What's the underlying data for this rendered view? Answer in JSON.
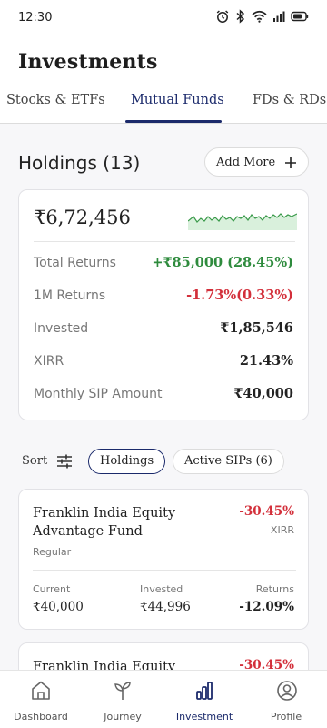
{
  "status": {
    "time": "12:30"
  },
  "page": {
    "title": "Investments"
  },
  "tabs": [
    {
      "label": "Stocks & ETFs",
      "active": false
    },
    {
      "label": "Mutual Funds",
      "active": true
    },
    {
      "label": "FDs & RDs",
      "active": false
    }
  ],
  "holdings": {
    "title": "Holdings (13)",
    "add_more_label": "Add More"
  },
  "summary": {
    "total_value": "₹6,72,456",
    "rows": [
      {
        "label": "Total Returns",
        "value": "+₹85,000 (28.45%)",
        "tone": "positive"
      },
      {
        "label": "1M Returns",
        "value": "-1.73%(0.33%)",
        "tone": "negative"
      },
      {
        "label": "Invested",
        "value": "₹1,85,546",
        "tone": "neutral"
      },
      {
        "label": "XIRR",
        "value": "21.43%",
        "tone": "neutral"
      },
      {
        "label": "Monthly SIP Amount",
        "value": "₹40,000",
        "tone": "neutral"
      }
    ]
  },
  "filters": {
    "sort_label": "Sort",
    "chips": [
      {
        "label": "Holdings",
        "selected": true
      },
      {
        "label": "Active SIPs (6)",
        "selected": false
      }
    ]
  },
  "funds": [
    {
      "name": "Franklin India Equity Advantage Fund",
      "xirr": "-30.45%",
      "xirr_label": "XIRR",
      "type": "Regular",
      "current_label": "Current",
      "current_value": "₹40,000",
      "invested_label": "Invested",
      "invested_value": "₹44,996",
      "returns_label": "Returns",
      "returns_value": "-12.09%"
    },
    {
      "name": "Franklin India Equity",
      "xirr": "-30.45%"
    }
  ],
  "bottom_nav": [
    {
      "label": "Dashboard",
      "icon": "home-icon",
      "active": false
    },
    {
      "label": "Journey",
      "icon": "sprout-icon",
      "active": false
    },
    {
      "label": "Investment",
      "icon": "bar-chart-icon",
      "active": true
    },
    {
      "label": "Profile",
      "icon": "user-icon",
      "active": false
    }
  ],
  "colors": {
    "accent": "#1b2a6b",
    "positive": "#2e8b3d",
    "negative": "#d32f3a"
  }
}
